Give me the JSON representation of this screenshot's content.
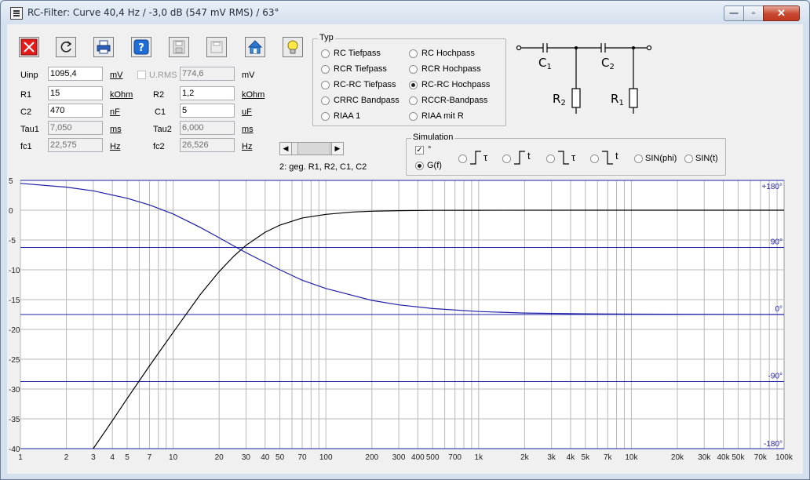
{
  "window": {
    "title": "RC-Filter: Curve 40,4 Hz / -3,0 dB (547 mV RMS) / 63°",
    "minimize_glyph": "—",
    "maximize_glyph": "▫",
    "close_glyph": "✕"
  },
  "toolbar": {
    "icons": [
      "close-icon",
      "refresh-icon",
      "print-icon",
      "help-icon",
      "save-icon",
      "save-as-icon",
      "home-icon",
      "lightbulb-icon"
    ]
  },
  "params": {
    "uinp_label": "Uinp",
    "uinp_value": "1095,4",
    "uinp_unit": "mV",
    "urms_label": "U.RMS",
    "urms_value": "774,6",
    "urms_unit": "mV",
    "r1_label": "R1",
    "r1_value": "15",
    "r1_unit": "kOhm",
    "r2_label": "R2",
    "r2_value": "1,2",
    "r2_unit": "kOhm",
    "c2_label": "C2",
    "c2_value": "470",
    "c2_unit": "nF",
    "c1_label": "C1",
    "c1_value": "5",
    "c1_unit": "uF",
    "tau1_label": "Tau1",
    "tau1_value": "7,050",
    "tau1_unit": "ms",
    "tau2_label": "Tau2",
    "tau2_value": "6,000",
    "tau2_unit": "ms",
    "fc1_label": "fc1",
    "fc1_value": "22,575",
    "fc1_unit": "Hz",
    "fc2_label": "fc2",
    "fc2_value": "26,526",
    "fc2_unit": "Hz"
  },
  "typ": {
    "caption": "Typ",
    "options": [
      "RC Tiefpass",
      "RC Hochpass",
      "RCR Tiefpass",
      "RCR Hochpass",
      "RC-RC Tiefpass",
      "RC-RC Hochpass",
      "CRRC Bandpass",
      "RCCR-Bandpass",
      "RIAA 1",
      "RIAA mit R"
    ],
    "selected": "RC-RC Hochpass"
  },
  "circuit": {
    "c1": "C",
    "c1_sub": "1",
    "c2": "C",
    "c2_sub": "2",
    "r2": "R",
    "r2_sub": "2",
    "r1": "R",
    "r1_sub": "1"
  },
  "scroll_hint": "2: geg. R1, R2, C1, C2",
  "simulation": {
    "caption": "Simulation",
    "degree_label": "°",
    "degree_checked": true,
    "gf_label": "G(f)",
    "step_labels": [
      "τ",
      "t",
      "τ",
      "t"
    ],
    "sinphi_label": "SIN(phi)",
    "sint_label": "SIN(t)"
  },
  "chart_data": {
    "type": "line",
    "xscale": "log",
    "xlim": [
      1,
      100000
    ],
    "ylim": [
      -40,
      5
    ],
    "grid": true,
    "x_ticks": [
      "1",
      "2",
      "3",
      "4",
      "5",
      "7",
      "10",
      "20",
      "30",
      "40",
      "50",
      "70",
      "100",
      "200",
      "300",
      "400",
      "500",
      "700",
      "1k",
      "2k",
      "3k",
      "4k",
      "5k",
      "7k",
      "10k",
      "20k",
      "30k",
      "40k",
      "50k",
      "70k",
      "100k"
    ],
    "x_tick_values": [
      1,
      2,
      3,
      4,
      5,
      7,
      10,
      20,
      30,
      40,
      50,
      70,
      100,
      200,
      300,
      400,
      500,
      700,
      1000,
      2000,
      3000,
      4000,
      5000,
      7000,
      10000,
      20000,
      30000,
      40000,
      50000,
      70000,
      100000
    ],
    "y_ticks": [
      "5",
      "0",
      "-5",
      "-10",
      "-15",
      "-20",
      "-25",
      "-30",
      "-35",
      "-40"
    ],
    "y_tick_values": [
      5,
      0,
      -5,
      -10,
      -15,
      -20,
      -25,
      -30,
      -35,
      -40
    ],
    "phase_ticks": [
      "+180°",
      "90°",
      "0°",
      "-90°",
      "-180°"
    ],
    "phase_tick_values": [
      180,
      90,
      0,
      -90,
      -180
    ],
    "phase_lim": [
      -180,
      180
    ],
    "series": [
      {
        "color": "#000000",
        "axis": "dB",
        "x": [
          3,
          4,
          5,
          7,
          10,
          15,
          20,
          25,
          30,
          40,
          50,
          70,
          100,
          150,
          200,
          300,
          500,
          1000,
          5000,
          100000
        ],
        "y": [
          -40.5,
          -35.3,
          -31.6,
          -26.1,
          -20.5,
          -14.2,
          -10.3,
          -7.7,
          -5.9,
          -3.7,
          -2.5,
          -1.3,
          -0.7,
          -0.3,
          -0.17,
          -0.08,
          -0.03,
          -0.01,
          0,
          0
        ]
      },
      {
        "color": "#1f1fa8",
        "axis": "phase",
        "x": [
          1,
          2,
          3,
          5,
          7,
          10,
          15,
          20,
          25,
          30,
          40,
          50,
          70,
          100,
          200,
          300,
          500,
          1000,
          2000,
          5000,
          10000,
          100000
        ],
        "y": [
          176,
          171,
          166,
          156,
          147,
          135,
          117,
          103,
          92,
          83,
          70,
          60,
          46,
          35,
          19,
          13,
          8,
          4,
          2,
          1,
          0.5,
          0
        ]
      }
    ]
  }
}
